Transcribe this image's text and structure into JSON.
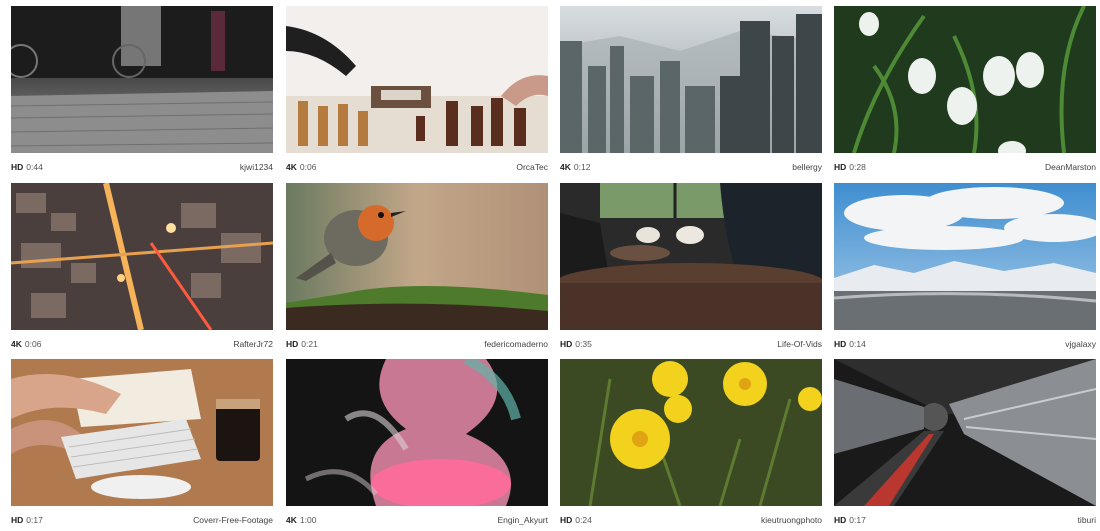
{
  "videos": [
    {
      "quality": "HD",
      "duration": "0:44",
      "author": "kjwi1234"
    },
    {
      "quality": "4K",
      "duration": "0:06",
      "author": "OrcaTec"
    },
    {
      "quality": "4K",
      "duration": "0:12",
      "author": "bellergy"
    },
    {
      "quality": "HD",
      "duration": "0:28",
      "author": "DeanMarston"
    },
    {
      "quality": "4K",
      "duration": "0:06",
      "author": "RafterJr72"
    },
    {
      "quality": "HD",
      "duration": "0:21",
      "author": "federicomaderno"
    },
    {
      "quality": "HD",
      "duration": "0:35",
      "author": "Life-Of-Vids"
    },
    {
      "quality": "HD",
      "duration": "0:14",
      "author": "vjgalaxy"
    },
    {
      "quality": "HD",
      "duration": "0:17",
      "author": "Coverr-Free-Footage"
    },
    {
      "quality": "4K",
      "duration": "1:00",
      "author": "Engin_Akyurt"
    },
    {
      "quality": "HD",
      "duration": "0:24",
      "author": "kieutruongphoto"
    },
    {
      "quality": "HD",
      "duration": "0:17",
      "author": "tiburi"
    }
  ]
}
